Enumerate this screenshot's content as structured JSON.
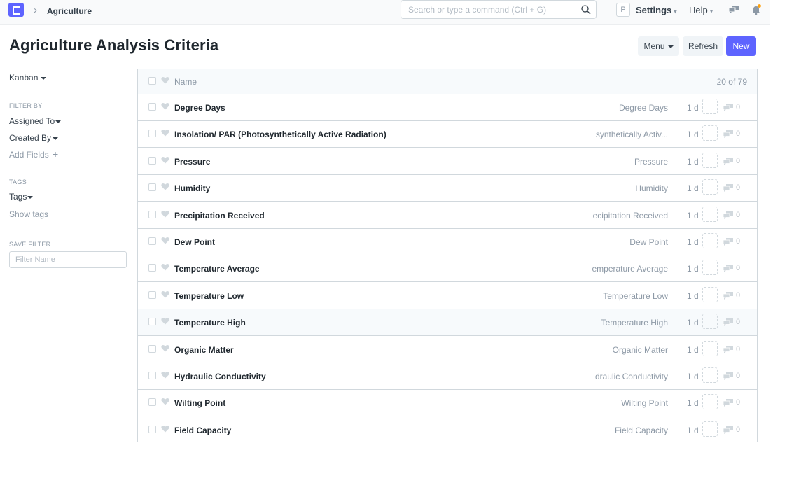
{
  "navbar": {
    "breadcrumb": "Agriculture",
    "search_placeholder": "Search or type a command (Ctrl + G)",
    "avatar_letter": "P",
    "settings_label": "Settings",
    "help_label": "Help"
  },
  "header": {
    "title": "Agriculture Analysis Criteria",
    "menu_label": "Menu",
    "refresh_label": "Refresh",
    "new_label": "New"
  },
  "sidebar": {
    "view_label": "Kanban",
    "filter_by_label": "FILTER BY",
    "assigned_to": "Assigned To",
    "created_by": "Created By",
    "add_fields": "Add Fields",
    "tags_section": "TAGS",
    "tags_label": "Tags",
    "show_tags": "Show tags",
    "save_filter_label": "SAVE FILTER",
    "filter_name_placeholder": "Filter Name"
  },
  "list": {
    "header_name": "Name",
    "count": "20 of 79",
    "rows": [
      {
        "name": "Degree Days",
        "field": "Degree Days",
        "modified": "1 d",
        "comments": "0"
      },
      {
        "name": "Insolation/ PAR (Photosynthetically Active Radiation)",
        "field": "synthetically Activ...",
        "modified": "1 d",
        "comments": "0"
      },
      {
        "name": "Pressure",
        "field": "Pressure",
        "modified": "1 d",
        "comments": "0"
      },
      {
        "name": "Humidity",
        "field": "Humidity",
        "modified": "1 d",
        "comments": "0"
      },
      {
        "name": "Precipitation Received",
        "field": "ecipitation Received",
        "modified": "1 d",
        "comments": "0"
      },
      {
        "name": "Dew Point",
        "field": "Dew Point",
        "modified": "1 d",
        "comments": "0"
      },
      {
        "name": "Temperature Average",
        "field": "emperature Average",
        "modified": "1 d",
        "comments": "0"
      },
      {
        "name": "Temperature Low",
        "field": "Temperature Low",
        "modified": "1 d",
        "comments": "0"
      },
      {
        "name": "Temperature High",
        "field": "Temperature High",
        "modified": "1 d",
        "comments": "0"
      },
      {
        "name": "Organic Matter",
        "field": "Organic Matter",
        "modified": "1 d",
        "comments": "0"
      },
      {
        "name": "Hydraulic Conductivity",
        "field": "draulic Conductivity",
        "modified": "1 d",
        "comments": "0"
      },
      {
        "name": "Wilting Point",
        "field": "Wilting Point",
        "modified": "1 d",
        "comments": "0"
      },
      {
        "name": "Field Capacity",
        "field": "Field Capacity",
        "modified": "1 d",
        "comments": "0"
      }
    ]
  },
  "colors": {
    "accent": "#5e64ff",
    "notification_dot": "#ffa00a"
  }
}
